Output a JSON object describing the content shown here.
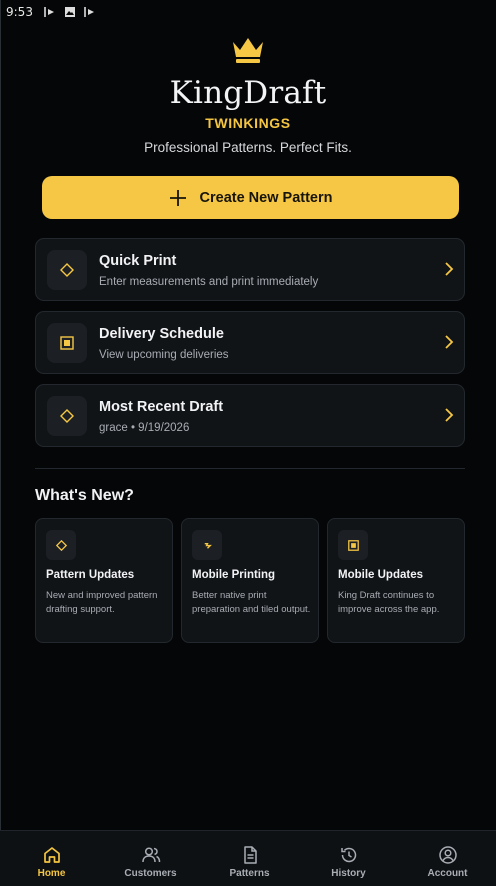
{
  "status_bar": {
    "time": "9:53",
    "icons": [
      "cast-icon",
      "image-icon",
      "cast-icon"
    ]
  },
  "brand": {
    "logo": "crown-icon",
    "title": "KingDraft",
    "subtitle": "TWINKINGS",
    "tagline": "Professional Patterns. Perfect Fits."
  },
  "cta": {
    "label": "Create New Pattern",
    "icon": "plus-icon"
  },
  "actions": [
    {
      "title": "Quick Print",
      "subtitle": "Enter measurements and print immediately",
      "icon": "diamond-icon"
    },
    {
      "title": "Delivery Schedule",
      "subtitle": "View upcoming deliveries",
      "icon": "square-icon"
    },
    {
      "title": "Most Recent Draft",
      "subtitle": "grace • 9/19/2026",
      "icon": "diamond-icon"
    }
  ],
  "whats_new": {
    "title": "What's New?",
    "items": [
      {
        "title": "Pattern Updates",
        "desc": "New and improved pattern drafting support.",
        "icon": "diamond-icon"
      },
      {
        "title": "Mobile Printing",
        "desc": "Better native print preparation and tiled output.",
        "icon": "bolt-icon"
      },
      {
        "title": "Mobile Updates",
        "desc": "King Draft continues to improve across the app.",
        "icon": "square-icon"
      }
    ]
  },
  "tabs": [
    {
      "label": "Home",
      "icon": "home-icon",
      "active": true
    },
    {
      "label": "Customers",
      "icon": "users-icon",
      "active": false
    },
    {
      "label": "Patterns",
      "icon": "document-icon",
      "active": false
    },
    {
      "label": "History",
      "icon": "history-icon",
      "active": false
    },
    {
      "label": "Account",
      "icon": "account-icon",
      "active": false
    }
  ],
  "colors": {
    "accent": "#f6c745",
    "background": "#050607",
    "card": "#111417",
    "muted_text": "#a8adb4"
  }
}
